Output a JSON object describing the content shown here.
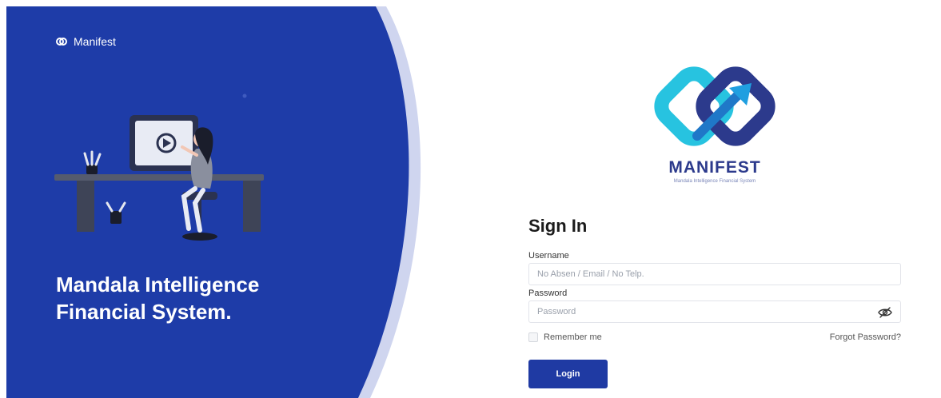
{
  "hero": {
    "brand_label": "Manifest",
    "title_line1": "Mandala Intelligence",
    "title_line2": "Financial System."
  },
  "logo": {
    "wordmark": "MANIFEST",
    "tagline": "Mandala Intelligence Financial System"
  },
  "form": {
    "title": "Sign In",
    "username_label": "Username",
    "username_placeholder": "No Absen / Email / No Telp.",
    "password_label": "Password",
    "password_placeholder": "Password",
    "remember_label": "Remember me",
    "forgot_label": "Forgot Password?",
    "login_label": "Login"
  },
  "colors": {
    "primary": "#1f3aa3",
    "hero_blue": "#1e3ca8",
    "logo_cyan": "#27c3e0",
    "logo_navy": "#2c3a8c"
  },
  "icons": {
    "brand": "manifest-logo-icon",
    "password_toggle": "eye-off-icon"
  }
}
